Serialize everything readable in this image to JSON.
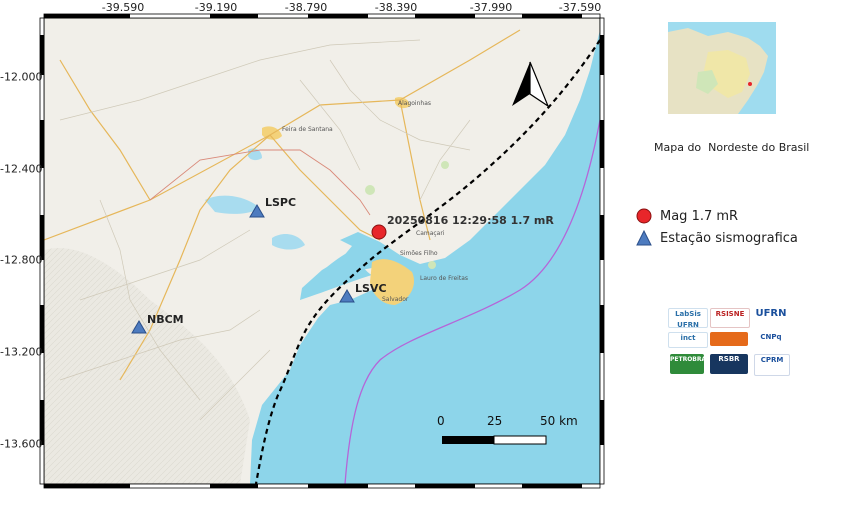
{
  "axes": {
    "top_ticks": [
      "-39.590",
      "-39.190",
      "-38.790",
      "-38.390",
      "-37.990",
      "-37.590"
    ],
    "left_ticks": [
      "-12.000",
      "-12.400",
      "-12.800",
      "-13.200",
      "-13.600"
    ]
  },
  "stations": [
    {
      "code": "LSPC"
    },
    {
      "code": "LSVC"
    },
    {
      "code": "NBCM"
    }
  ],
  "event": {
    "label": "20250816 12:29:58 1.7 mR"
  },
  "city_labels": [
    "Alagoinhas",
    "Feira de Santana",
    "Camaçari",
    "Simões Filho",
    "Lauro de Freitas",
    "Salvador"
  ],
  "scale_bar": {
    "labels": [
      "0",
      "25",
      "50 km"
    ]
  },
  "legend": {
    "items": [
      {
        "label": "Mag 1.7 mR",
        "symbol": "red-circle"
      },
      {
        "label": "Estação sismografica",
        "symbol": "blue-triangle"
      }
    ]
  },
  "inset": {
    "caption": "Mapa do  Nordeste do Brasil"
  },
  "logos": {
    "items": [
      "LabSis UFRN",
      "RSISNE",
      "UFRN",
      "inct",
      "CNPq",
      "PETROBRAS",
      "RSBR",
      "CPRM"
    ]
  },
  "colors": {
    "ocean": "#8dd5ea",
    "land": "#f1efe9",
    "event": "#e8262a",
    "station": "#4d7bbf",
    "fault_line": "#000000",
    "boundary": "#b565d8"
  }
}
